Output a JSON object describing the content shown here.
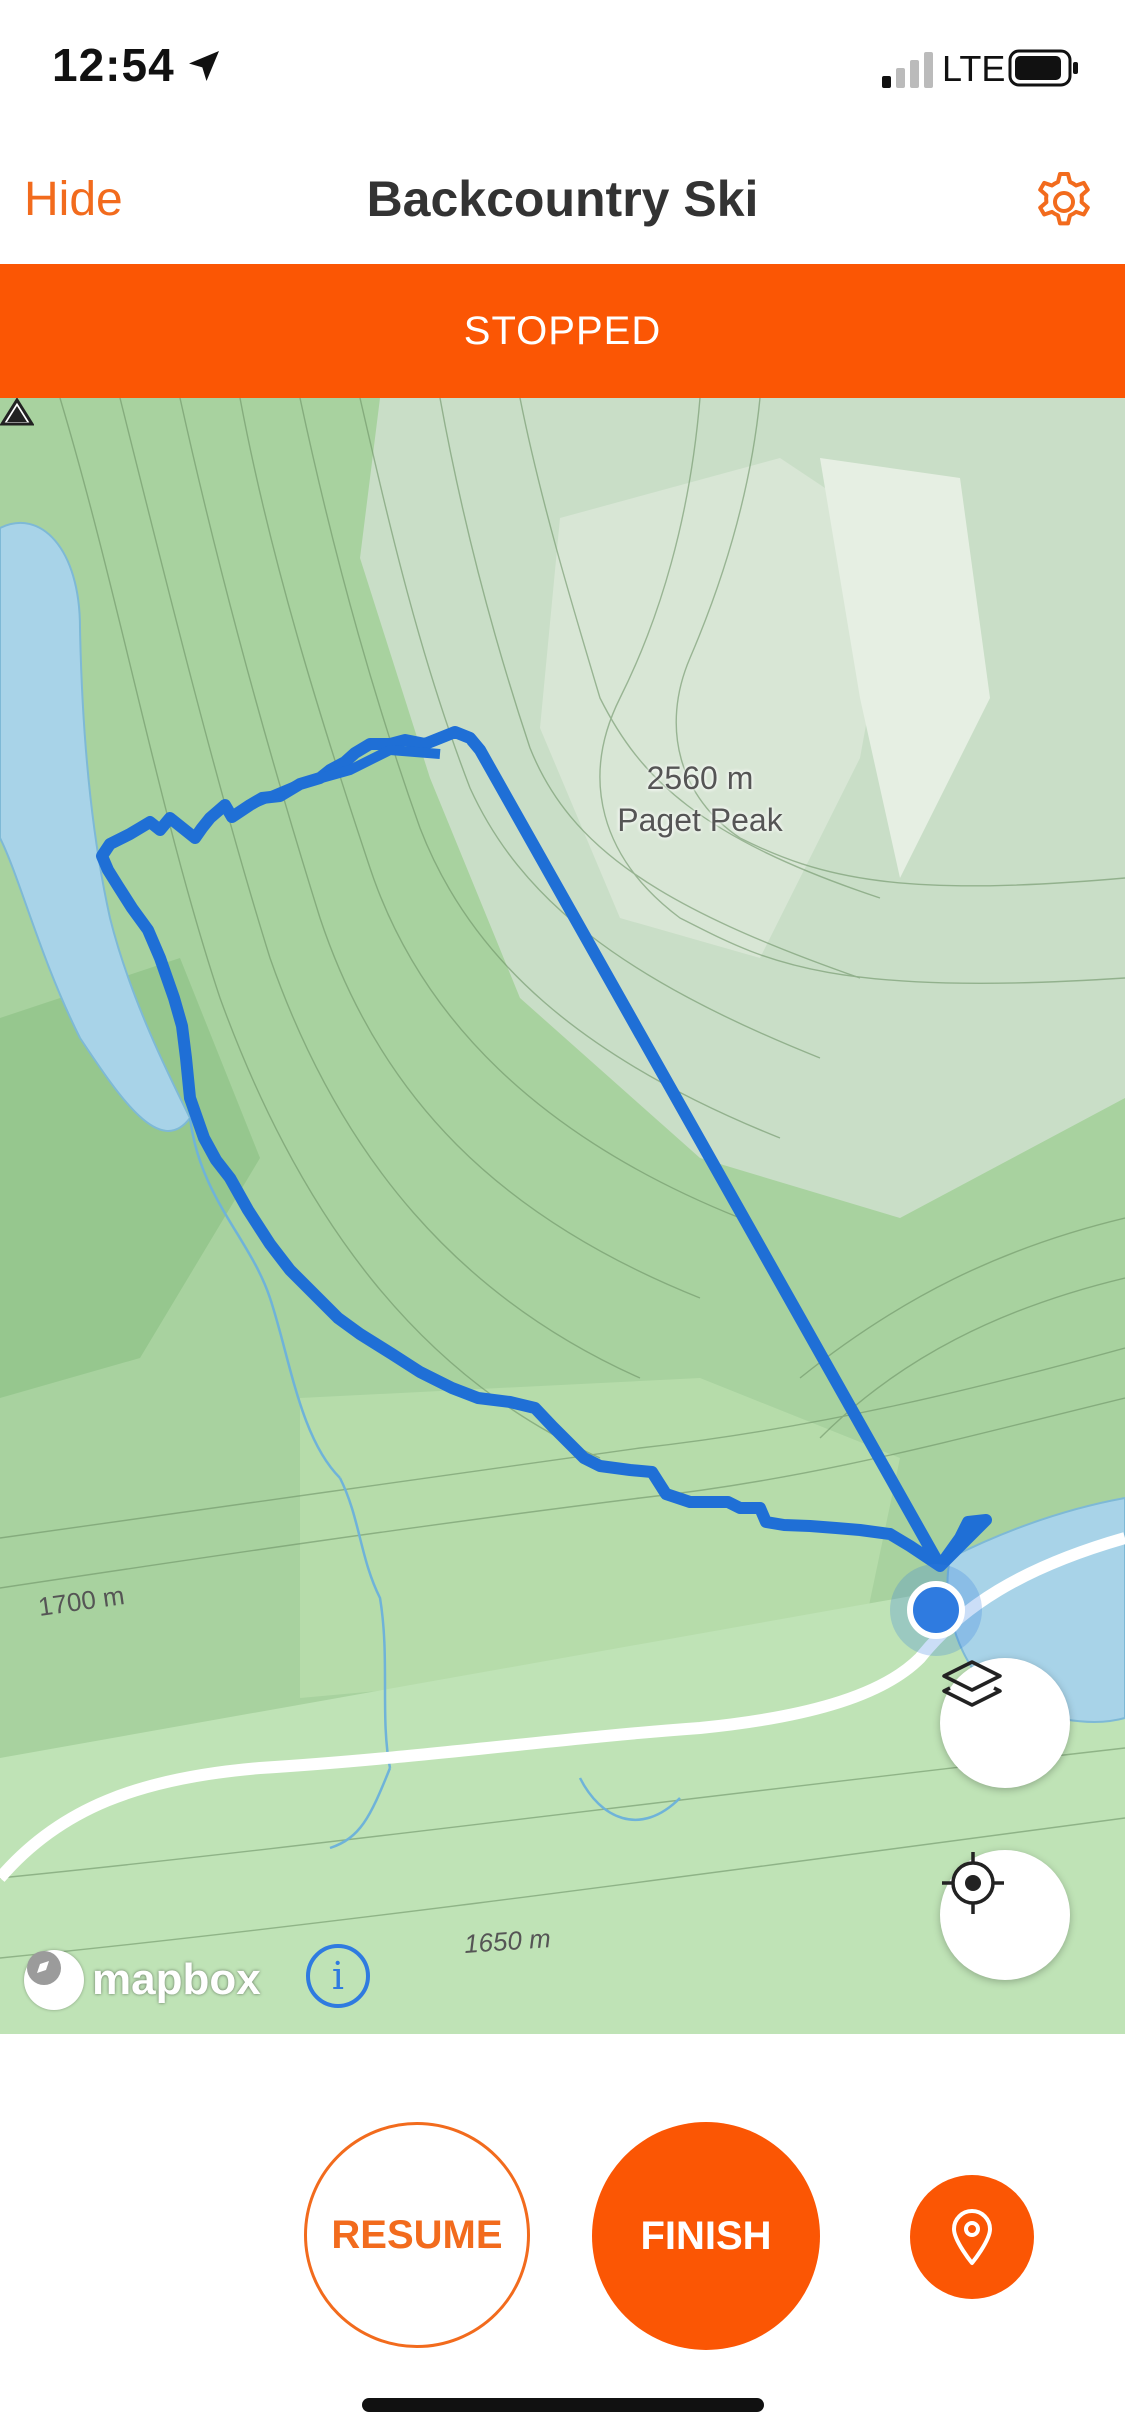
{
  "status_bar": {
    "time": "12:54",
    "network": "LTE"
  },
  "header": {
    "hide_label": "Hide",
    "title": "Backcountry Ski"
  },
  "banner": {
    "status": "STOPPED",
    "color": "#fb5604"
  },
  "map": {
    "peak_elevation": "2560 m",
    "peak_name": "Paget Peak",
    "contour_labels": [
      "1700 m",
      "1650 m"
    ],
    "attribution": "mapbox",
    "route_color": "#1f6fd6",
    "icons": [
      "layers-icon",
      "locate-icon",
      "info-icon",
      "mountain-peak-icon",
      "current-location-dot"
    ]
  },
  "actions": {
    "resume_label": "RESUME",
    "finish_label": "FINISH",
    "accent": "#fb5604"
  }
}
